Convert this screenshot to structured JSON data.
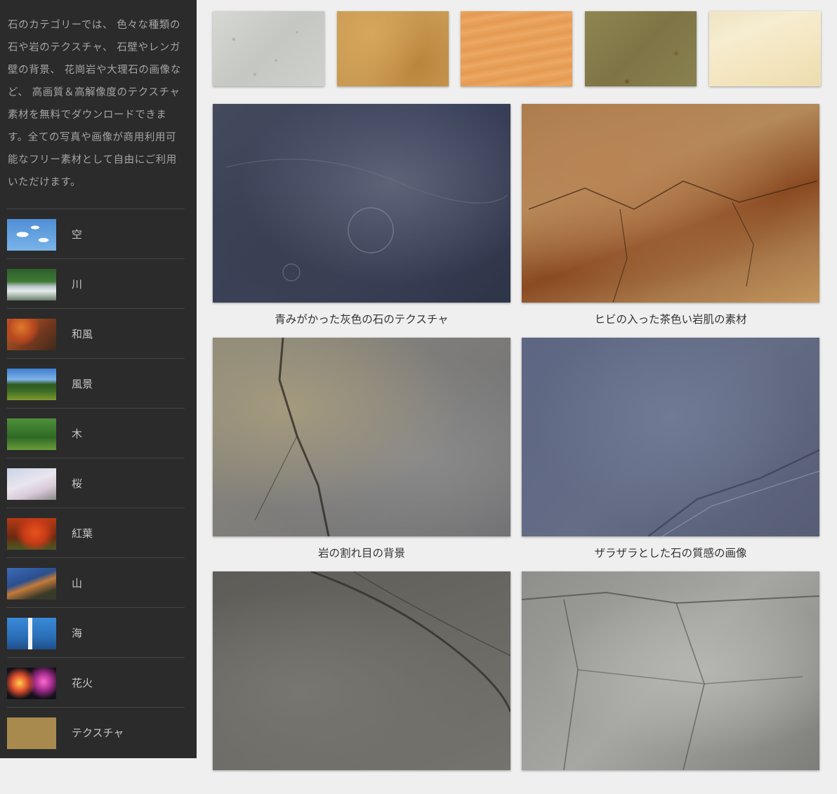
{
  "sidebar": {
    "intro": "石のカテゴリーでは、 色々な種類の石や岩のテクスチャ、 石壁やレンガ壁の背景、 花崗岩や大理石の画像など、 高画質＆高解像度のテクスチャ素材を無料でダウンロードできます。全ての写真や画像が商用利用可能なフリー素材として自由にご利用いただけます。",
    "categories": [
      {
        "label": "空"
      },
      {
        "label": "川"
      },
      {
        "label": "和風"
      },
      {
        "label": "風景"
      },
      {
        "label": "木"
      },
      {
        "label": "桜"
      },
      {
        "label": "紅葉"
      },
      {
        "label": "山"
      },
      {
        "label": "海"
      },
      {
        "label": "花火"
      },
      {
        "label": "テクスチャ"
      }
    ]
  },
  "textures": [
    {
      "name": "concrete"
    },
    {
      "name": "cork"
    },
    {
      "name": "sand-dune"
    },
    {
      "name": "olive-paper"
    },
    {
      "name": "cream-paper"
    }
  ],
  "gallery": [
    {
      "caption": "青みがかった灰色の石のテクスチャ"
    },
    {
      "caption": "ヒビの入った茶色い岩肌の素材"
    },
    {
      "caption": "岩の割れ目の背景"
    },
    {
      "caption": "ザラザラとした石の質感の画像"
    },
    {
      "caption": ""
    },
    {
      "caption": ""
    }
  ]
}
